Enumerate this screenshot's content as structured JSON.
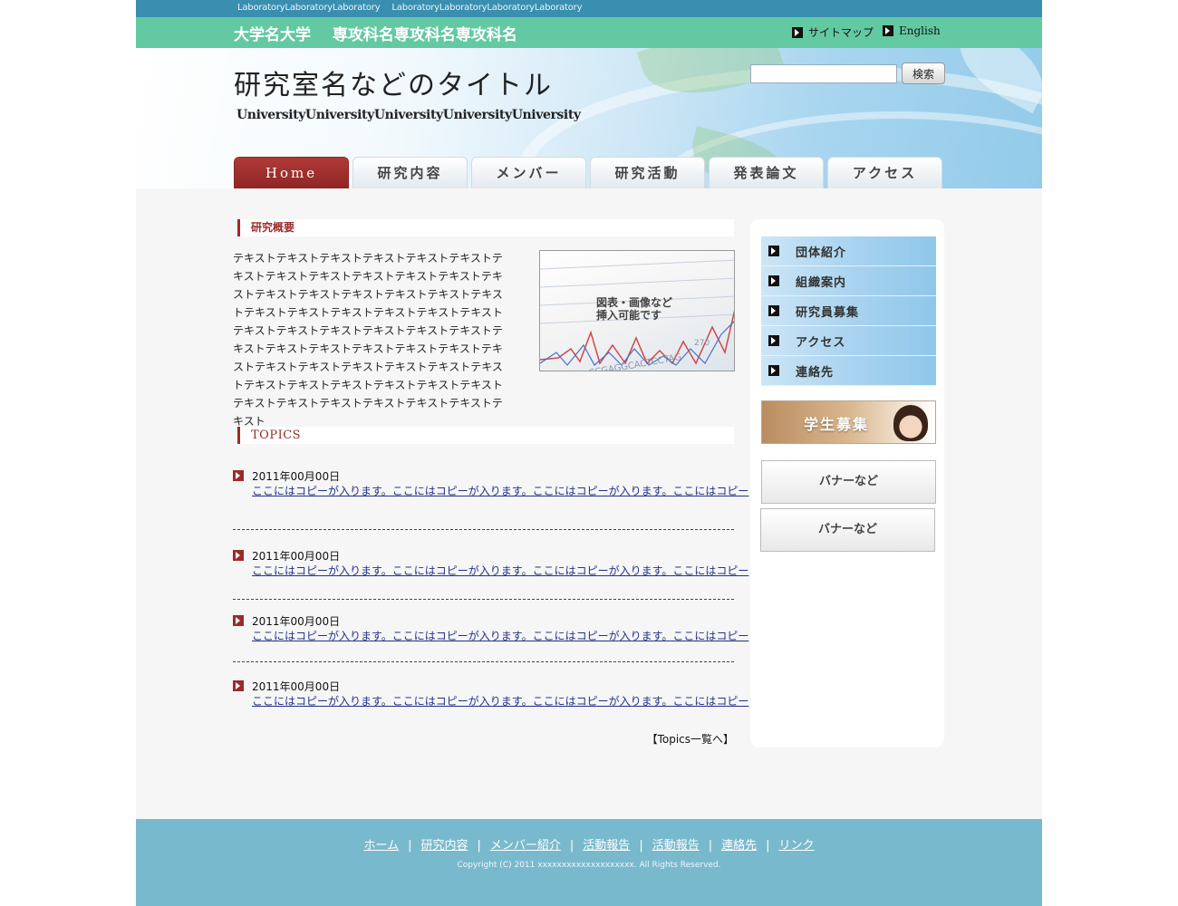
{
  "topbar": {
    "labs": [
      "LaboratoryLaboratoryLaboratory",
      "LaboratoryLaboratoryLaboratoryLaboratory"
    ]
  },
  "header": {
    "univ_name": "大学名大学",
    "dept_name": "専攻科名専攻科名専攻科名",
    "links": {
      "sitemap": "サイトマップ",
      "english": "English"
    },
    "title": "研究室名などのタイトル",
    "subtitle": "UniversityUniversityUniversityUniversityUniversity"
  },
  "search": {
    "value": "",
    "placeholder": "",
    "button": "検索"
  },
  "gnav": {
    "items": [
      "Home",
      "研究内容",
      "メンバー",
      "研究活動",
      "発表論文",
      "アクセス"
    ]
  },
  "summary": {
    "heading": "研究概要",
    "text": "テキストテキストテキストテキストテキストテキストテキストテキストテキストテキストテキストテキストテキストテキストテキストテキストテキストテキストテキストテキストテキストテキストテキストテキストテキストテキストテキストテキストテキストテキストテキストテキストテキストテキストテキストテキストテキストテキストテキストテキストテキストテキストテキストテキストテキストテキストテキストテキストテキストテキストテキストテキストテキストテキストテキストテキストテキスト",
    "figure_caption_1": "図表・画像など",
    "figure_caption_2": "挿入可能です"
  },
  "topics": {
    "heading": "TOPICS",
    "items": [
      {
        "date": "2011年00月00日",
        "text": "ここにはコピーが入ります。ここにはコピーが入ります。ここにはコピーが入ります。ここにはコピー"
      },
      {
        "date": "2011年00月00日",
        "text": "ここにはコピーが入ります。ここにはコピーが入ります。ここにはコピーが入ります。ここにはコピー"
      },
      {
        "date": "2011年00月00日",
        "text": "ここにはコピーが入ります。ここにはコピーが入ります。ここにはコピーが入ります。ここにはコピー"
      },
      {
        "date": "2011年00月00日",
        "text": "ここにはコピーが入ります。ここにはコピーが入ります。ここにはコピーが入ります。ここにはコピー"
      }
    ],
    "more": "【Topics一覧へ】"
  },
  "sidebar": {
    "items": [
      "団体紹介",
      "組織案内",
      "研究員募集",
      "アクセス",
      "連絡先"
    ],
    "recruit": "学生募集",
    "banners": [
      "バナーなど",
      "バナーなど"
    ]
  },
  "footer": {
    "links": [
      "ホーム",
      "研究内容",
      "メンバー紹介",
      "活動報告",
      "活動報告",
      "連絡先",
      "リンク"
    ],
    "copyright": "Copyright (C) 2011 xxxxxxxxxxxxxxxxxxxx. All Rights Reserved."
  },
  "colors": {
    "accent_red": "#9b2b29",
    "topbar_blue": "#3a8fb0",
    "header_green": "#63c9a3",
    "footer_blue": "#79b9ce"
  },
  "icons": {
    "link_arrow": "arrow-right-icon",
    "topic_arrow": "arrow-right-icon"
  }
}
